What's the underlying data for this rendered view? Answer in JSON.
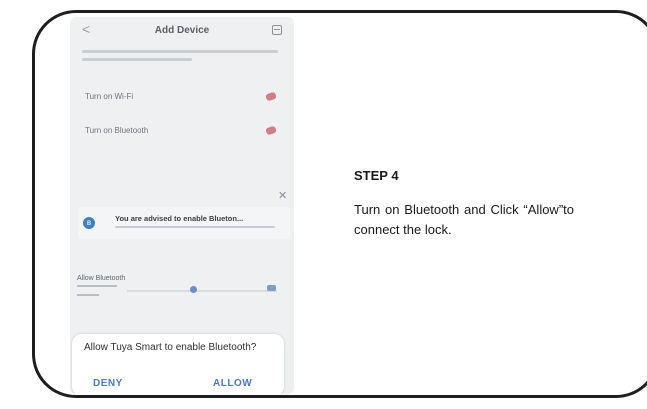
{
  "phone": {
    "header": {
      "back_icon": "<",
      "title": "Add Device",
      "scan_icon": "scan-icon"
    },
    "rows": [
      {
        "label": "Turn on Wi-Fi"
      },
      {
        "label": "Turn on Bluetooth"
      }
    ],
    "bluetooth_notice": "You are advised to enable Blueton...",
    "allow_label": "Allow Bluetooth",
    "dialog": {
      "message": "Allow Tuya Smart to enable Bluetooth?",
      "deny_label": "DENY",
      "allow_label": "ALLOW"
    }
  },
  "instructions": {
    "step_title": "STEP 4",
    "step_text": "Turn on Bluetooth and Click “Allow”to connect the lock."
  },
  "colors": {
    "frame": "#1e1e1e",
    "accent": "#4b79c2",
    "check": "#d27a86"
  }
}
